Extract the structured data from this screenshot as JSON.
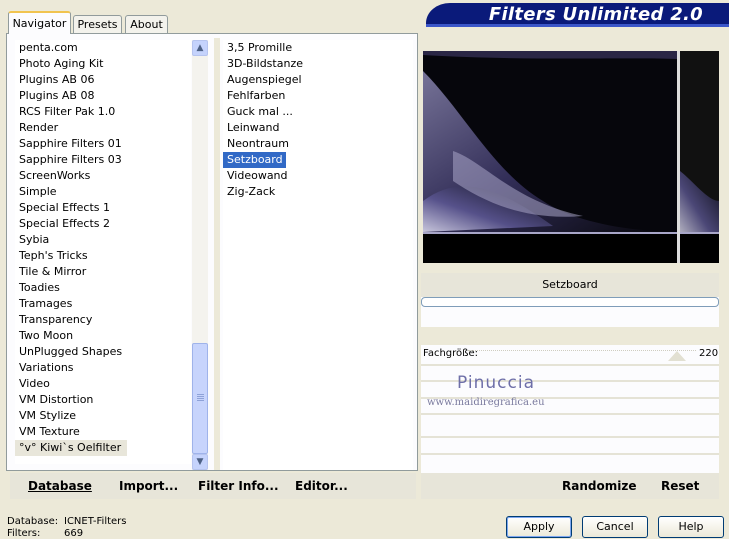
{
  "app": {
    "title": "Filters Unlimited 2.0"
  },
  "tabs": [
    {
      "label": "Navigator",
      "active": true
    },
    {
      "label": "Presets",
      "active": false
    },
    {
      "label": "About",
      "active": false
    }
  ],
  "categories": [
    "penta.com",
    "Photo Aging Kit",
    "Plugins AB 06",
    "Plugins AB 08",
    "RCS Filter Pak 1.0",
    "Render",
    "Sapphire Filters 01",
    "Sapphire Filters 03",
    "ScreenWorks",
    "Simple",
    "Special Effects 1",
    "Special Effects 2",
    "Sybia",
    "Teph's Tricks",
    "Tile & Mirror",
    "Toadies",
    "Tramages",
    "Transparency",
    "Two Moon",
    "UnPlugged Shapes",
    "Variations",
    "Video",
    "VM Distortion",
    "VM Stylize",
    "VM Texture",
    "°v° Kiwi`s Oelfilter"
  ],
  "selected_category": "°v° Kiwi`s Oelfilter",
  "filters": [
    "3,5 Promille",
    "3D-Bildstanze",
    "Augenspiegel",
    "Fehlfarben",
    "Guck mal ...",
    "Leinwand",
    "Neontraum",
    "Setzboard",
    "Videowand",
    "Zig-Zack"
  ],
  "selected_filter": "Setzboard",
  "left_buttons": {
    "database": "Database",
    "import": "Import...",
    "filter_info": "Filter Info...",
    "editor": "Editor..."
  },
  "right_buttons": {
    "randomize": "Randomize",
    "reset": "Reset"
  },
  "filter_name": "Setzboard",
  "parameter": {
    "label": "Fachgröße:",
    "value": "220"
  },
  "watermark": {
    "name": "Pinuccia",
    "site": "www.maidiregrafica.eu"
  },
  "status": {
    "database_label": "Database:",
    "database_value": "ICNET-Filters",
    "filters_label": "Filters:",
    "filters_value": "669"
  },
  "dialog_buttons": {
    "apply": "Apply",
    "cancel": "Cancel",
    "help": "Help"
  },
  "colors": {
    "banner": "#0a1a7a",
    "selection": "#3169c6",
    "active_tab_accent": "#f1c44f"
  }
}
